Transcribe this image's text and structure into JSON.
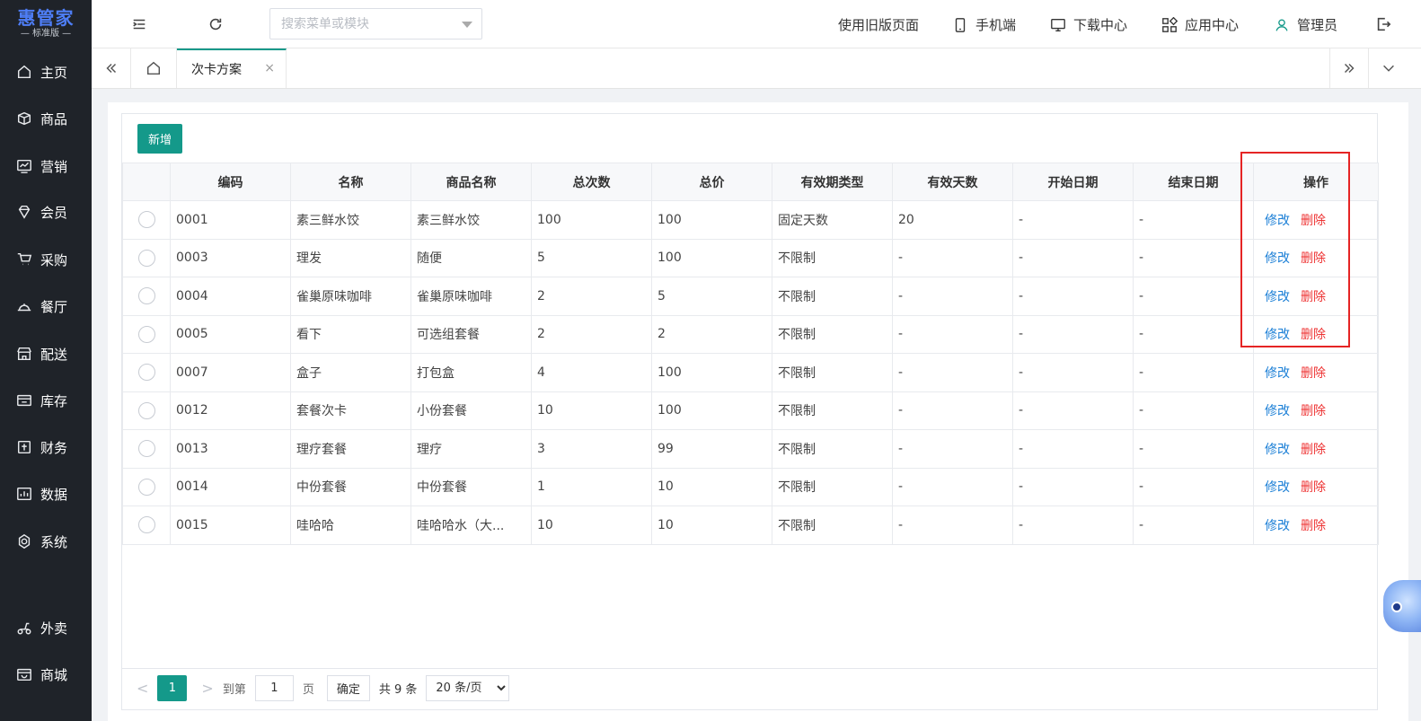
{
  "brand": {
    "name": "惠管家",
    "edition": "— 标准版 —"
  },
  "sidebar": {
    "items": [
      {
        "label": "主页",
        "icon": "home-icon"
      },
      {
        "label": "商品",
        "icon": "box-icon"
      },
      {
        "label": "营销",
        "icon": "chart-icon"
      },
      {
        "label": "会员",
        "icon": "diamond-icon"
      },
      {
        "label": "采购",
        "icon": "cart-icon"
      },
      {
        "label": "餐厅",
        "icon": "cloche-icon"
      },
      {
        "label": "配送",
        "icon": "store-icon"
      },
      {
        "label": "库存",
        "icon": "inventory-icon"
      },
      {
        "label": "财务",
        "icon": "finance-icon"
      },
      {
        "label": "数据",
        "icon": "data-icon"
      },
      {
        "label": "系统",
        "icon": "settings-icon"
      },
      {
        "label": "外卖",
        "icon": "scooter-icon"
      },
      {
        "label": "商城",
        "icon": "mall-icon"
      }
    ]
  },
  "header": {
    "search_placeholder": "搜索菜单或模块",
    "old_version": "使用旧版页面",
    "mobile": "手机端",
    "download": "下载中心",
    "apps": "应用中心",
    "user": "管理员"
  },
  "tabs": {
    "active_label": "次卡方案",
    "close_symbol": "×"
  },
  "toolbar": {
    "new_label": "新增"
  },
  "table": {
    "columns": [
      "编码",
      "名称",
      "商品名称",
      "总次数",
      "总价",
      "有效期类型",
      "有效天数",
      "开始日期",
      "结束日期",
      "操作"
    ],
    "edit_label": "修改",
    "delete_label": "删除",
    "rows": [
      {
        "code": "0001",
        "name": "素三鲜水饺",
        "product": "素三鲜水饺",
        "times": "100",
        "price": "100",
        "validity_type": "固定天数",
        "days": "20",
        "start": "-",
        "end": "-"
      },
      {
        "code": "0003",
        "name": "理发",
        "product": "随便",
        "times": "5",
        "price": "100",
        "validity_type": "不限制",
        "days": "-",
        "start": "-",
        "end": "-"
      },
      {
        "code": "0004",
        "name": "雀巢原味咖啡",
        "product": "雀巢原味咖啡",
        "times": "2",
        "price": "5",
        "validity_type": "不限制",
        "days": "-",
        "start": "-",
        "end": "-"
      },
      {
        "code": "0005",
        "name": "看下",
        "product": "可选组套餐",
        "times": "2",
        "price": "2",
        "validity_type": "不限制",
        "days": "-",
        "start": "-",
        "end": "-"
      },
      {
        "code": "0007",
        "name": "盒子",
        "product": "打包盒",
        "times": "4",
        "price": "100",
        "validity_type": "不限制",
        "days": "-",
        "start": "-",
        "end": "-"
      },
      {
        "code": "0012",
        "name": "套餐次卡",
        "product": "小份套餐",
        "times": "10",
        "price": "100",
        "validity_type": "不限制",
        "days": "-",
        "start": "-",
        "end": "-"
      },
      {
        "code": "0013",
        "name": "理疗套餐",
        "product": "理疗",
        "times": "3",
        "price": "99",
        "validity_type": "不限制",
        "days": "-",
        "start": "-",
        "end": "-"
      },
      {
        "code": "0014",
        "name": "中份套餐",
        "product": "中份套餐",
        "times": "1",
        "price": "10",
        "validity_type": "不限制",
        "days": "-",
        "start": "-",
        "end": "-"
      },
      {
        "code": "0015",
        "name": "哇哈哈",
        "product": "哇哈哈水（大...",
        "times": "10",
        "price": "10",
        "validity_type": "不限制",
        "days": "-",
        "start": "-",
        "end": "-"
      }
    ]
  },
  "pagination": {
    "prev": "<",
    "current_page": "1",
    "next": ">",
    "goto_label": "到第",
    "goto_value": "1",
    "page_unit": "页",
    "confirm_label": "确定",
    "total_text": "共 9 条",
    "page_size": "20 条/页"
  },
  "colors": {
    "accent": "#14998a",
    "sidebar_bg": "#1f2329",
    "edit_link": "#1b7fd6",
    "delete_link": "#e33333",
    "highlight": "#e52424"
  }
}
